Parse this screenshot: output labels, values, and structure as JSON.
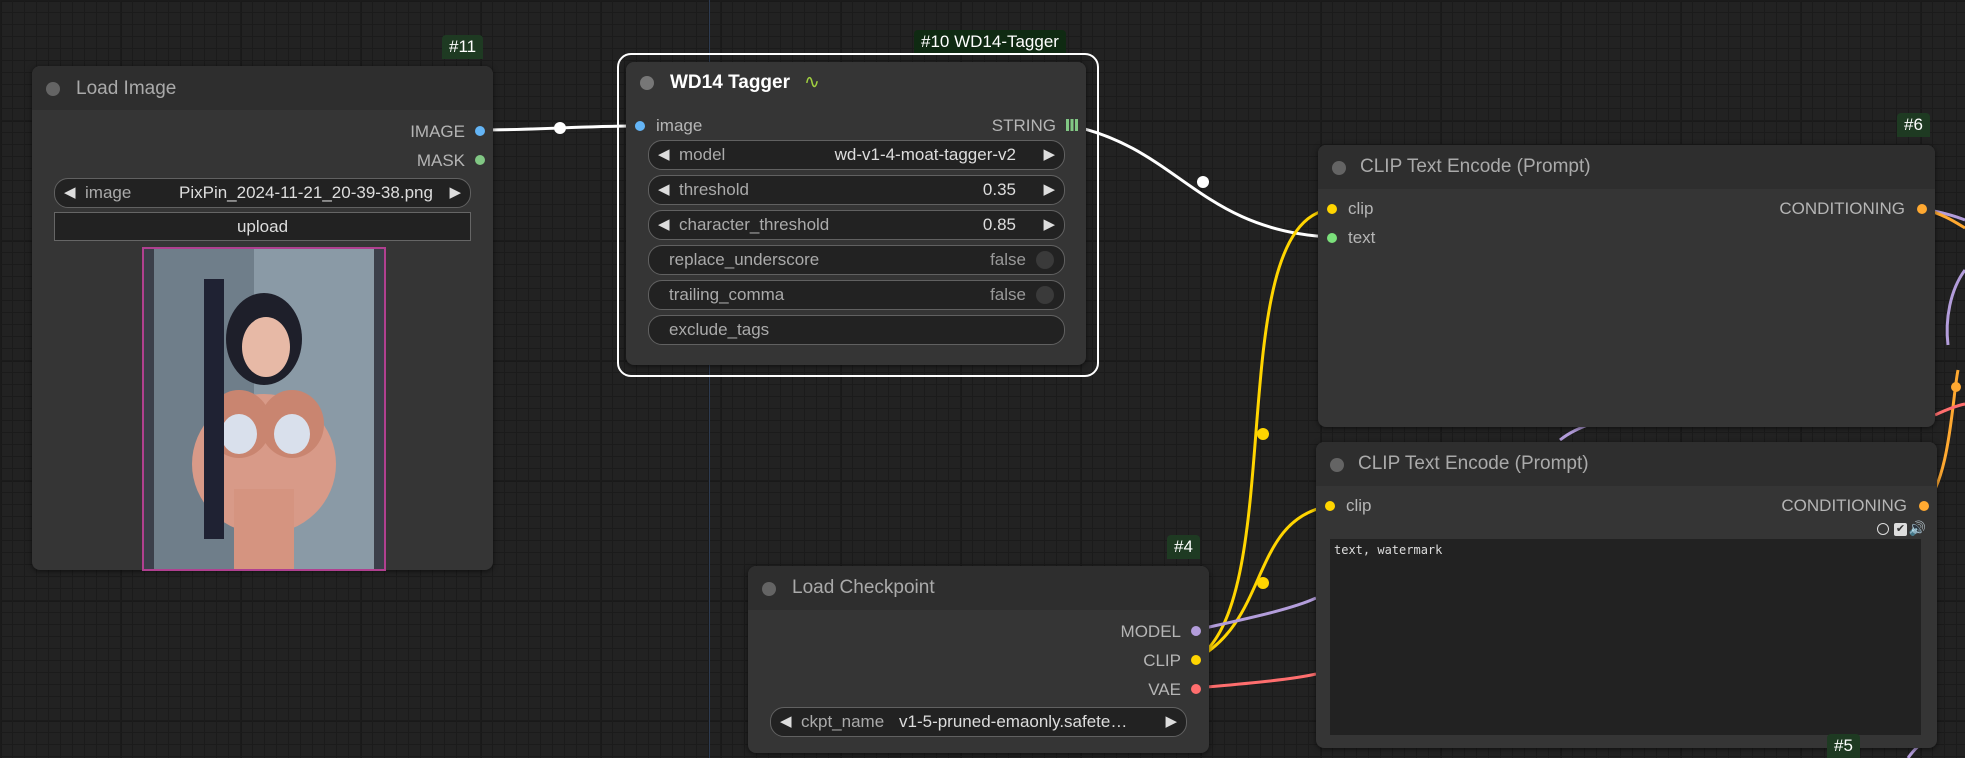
{
  "canvas": {
    "colors": {
      "background": "#222222",
      "node_bg": "#353535",
      "node_header": "#2e2e2e",
      "badge": "#1e3a22",
      "clip_wire": "#ffd500",
      "string_wire": "#ffffff",
      "model_wire": "#b39ddb",
      "vae_wire": "#ff6e6e",
      "cond_wire": "#ffa931"
    }
  },
  "load_image": {
    "badge": "#11",
    "title": "Load Image",
    "outputs": [
      {
        "label": "IMAGE",
        "color": "#64b5f6"
      },
      {
        "label": "MASK",
        "color": "#81c784"
      }
    ],
    "image_widget": {
      "label": "image",
      "value": "PixPin_2024-11-21_20-39-38.png"
    },
    "upload_label": "upload",
    "preview_icon": "image-preview"
  },
  "tagger": {
    "badge": "#10 WD14-Tagger",
    "title": "WD14 Tagger",
    "title_icon": "snake-icon",
    "input": {
      "label": "image",
      "color": "#64b5f6"
    },
    "output": {
      "label": "STRING",
      "icon": "grid-icon",
      "color": "#81c784"
    },
    "widgets": {
      "model": {
        "label": "model",
        "value": "wd-v1-4-moat-tagger-v2"
      },
      "threshold": {
        "label": "threshold",
        "value": "0.35"
      },
      "character_threshold": {
        "label": "character_threshold",
        "value": "0.85"
      },
      "replace_underscore": {
        "label": "replace_underscore",
        "value": "false"
      },
      "trailing_comma": {
        "label": "trailing_comma",
        "value": "false"
      },
      "exclude_tags": {
        "label": "exclude_tags"
      }
    }
  },
  "clip_pos": {
    "badge": "#6",
    "title": "CLIP Text Encode (Prompt)",
    "inputs": [
      {
        "label": "clip",
        "color": "#ffd500"
      },
      {
        "label": "text",
        "color": "#7be07b"
      }
    ],
    "output": {
      "label": "CONDITIONING",
      "color": "#ffa931"
    }
  },
  "clip_neg": {
    "badge": "#5",
    "title": "CLIP Text Encode (Prompt)",
    "input": {
      "label": "clip",
      "color": "#ffd500"
    },
    "output": {
      "label": "CONDITIONING",
      "color": "#ffa931"
    },
    "text": "text, watermark",
    "toolbar_icons": [
      "circle-icon",
      "checkbox-icon",
      "speaker-icon"
    ]
  },
  "checkpoint": {
    "badge": "#4",
    "title": "Load Checkpoint",
    "outputs": [
      {
        "label": "MODEL",
        "color": "#b39ddb"
      },
      {
        "label": "CLIP",
        "color": "#ffd500"
      },
      {
        "label": "VAE",
        "color": "#ff6e6e"
      }
    ],
    "widget": {
      "label": "ckpt_name",
      "value": "v1-5-pruned-emaonly.safete…"
    }
  }
}
